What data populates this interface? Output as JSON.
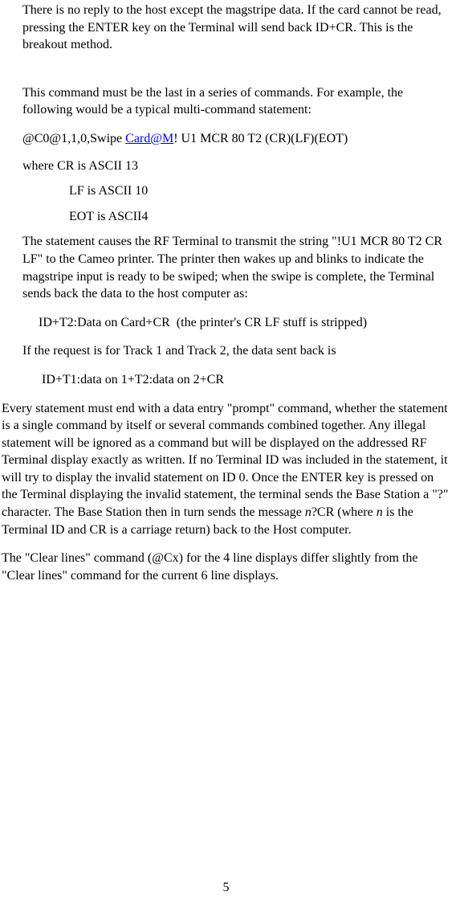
{
  "p1": "There is no reply to the host except the magstripe data. If the card cannot be read, pressing the ENTER key on the Terminal will send back ID+CR. This is the breakout method.",
  "p2": "This command must be the last in a series of commands. For example, the following would be a typical multi-command statement:",
  "cmd_prefix": "@C0@1,1,0,Swipe ",
  "cmd_link": "Card@M",
  "cmd_suffix": "! U1 MCR 80 T2 (CR)(LF)(EOT)",
  "ascii1": "where CR is ASCII 13",
  "ascii2": "LF is ASCII 10",
  "ascii3": "EOT is ASCII4",
  "p3": "The statement causes the RF Terminal to transmit the string \"!U1 MCR 80 T2 CR LF\"  to the Cameo printer. The printer then wakes up and blinks to indicate the magstripe input is ready to be swiped; when the swipe is complete, the Terminal sends back the data to the host computer as:",
  "result1": "     ID+T2:Data on Card+CR  (the printer's CR LF stuff is stripped)",
  "p4": "If the request is for Track 1 and Track 2, the data sent back is",
  "result2": "ID+T1:data on 1+T2:data on 2+CR",
  "p5a": "Every statement must end with a data entry \"prompt\" command, whether the statement is a single command by itself or several commands combined together. Any illegal statement will be ignored as a command but will be displayed on the addressed RF Terminal display exactly as written. If no Terminal ID was included in the statement, it will try to display the invalid statement on ID 0. Once the ENTER key is pressed on the Terminal displaying the invalid statement, the terminal sends the Base Station a \"?\" character. The Base Station then in turn sends the message ",
  "p5_n1": "n",
  "p5b": "?CR (where ",
  "p5_n2": "n",
  "p5c": " is the Terminal ID and CR is a carriage return) back to the Host computer.",
  "p6": "The \"Clear lines\" command (@Cx) for the 4 line displays differ slightly from the \"Clear lines\" command for the current 6 line displays.",
  "page_number": "5"
}
